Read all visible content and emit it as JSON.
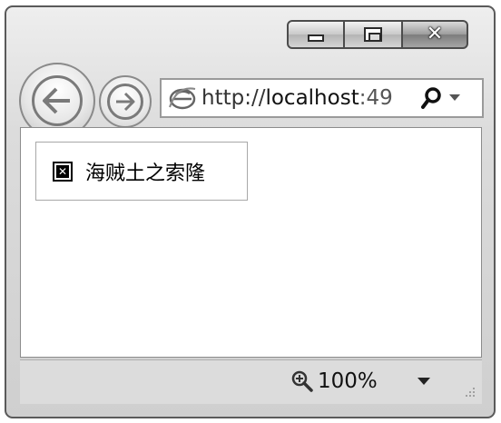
{
  "window": {
    "address_bar": {
      "url_prefix": "http://",
      "url_host": "localhost",
      "url_rest": ":49"
    },
    "content": {
      "broken_image_alt": "海贼土之索隆"
    },
    "status_bar": {
      "zoom": "100%"
    }
  },
  "icons": {
    "back": "back-arrow-icon",
    "forward": "forward-arrow-icon",
    "page": "ie-page-icon",
    "search": "search-icon",
    "zoom": "zoom-magnifier-icon"
  }
}
